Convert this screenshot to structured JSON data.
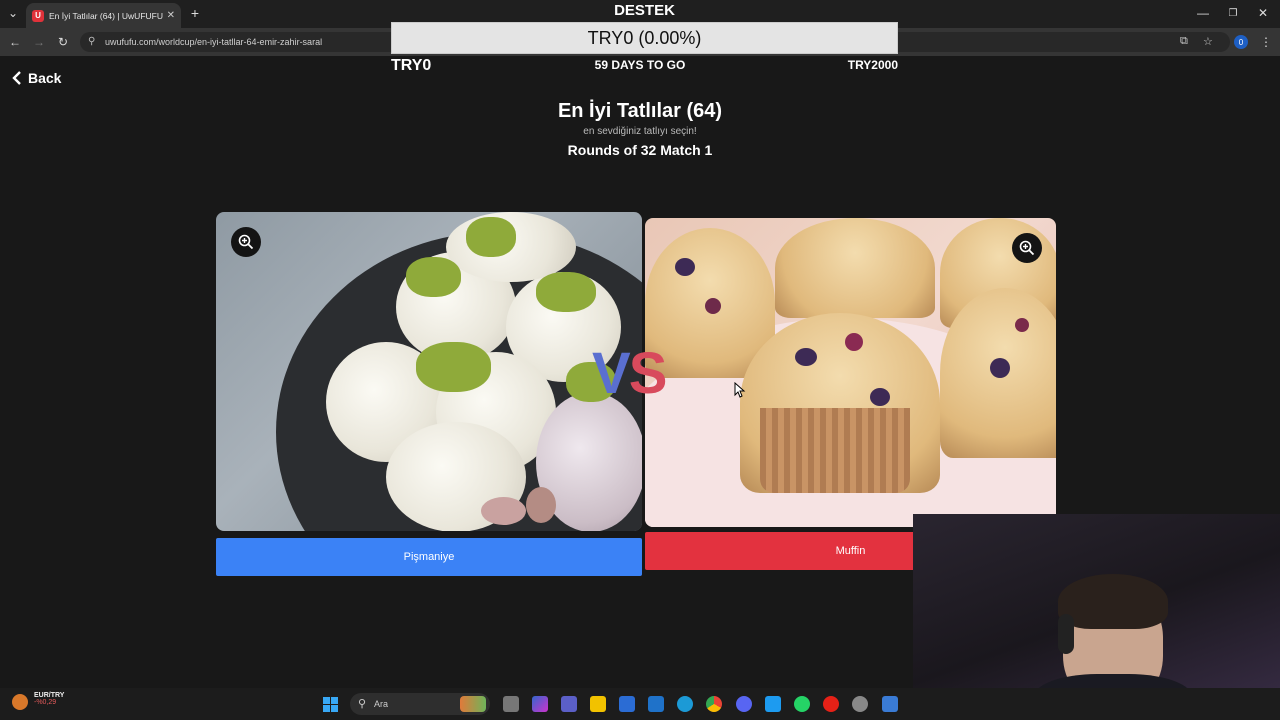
{
  "browser": {
    "tab_title": "En İyi Tatlılar (64) | UwUFUFU",
    "tab_favicon": "U",
    "url": "uwufufu.com/worldcup/en-iyi-tatllar-64-emir-zahir-saral",
    "profile_initial": "0"
  },
  "donation": {
    "title": "DESTEK",
    "progress_text": "TRY0 (0.00%)",
    "progress_fraction": 0.0,
    "current": "TRY0",
    "countdown": "59 DAYS TO GO",
    "goal": "TRY2000"
  },
  "page": {
    "back_label": "Back",
    "title": "En İyi Tatlılar (64)",
    "subtitle": "en sevdiğiniz tatlıyı seçin!",
    "round": "Rounds of 32 Match 1"
  },
  "match": {
    "vs_v": "V",
    "vs_s": "S",
    "left": {
      "label": "Pişmaniye",
      "color": "#3b82f6"
    },
    "right": {
      "label": "Muffin",
      "color": "#e3323f"
    }
  },
  "taskbar": {
    "weather_title": "EUR/TRY",
    "weather_change": "-%0,29",
    "search_placeholder": "Ara"
  }
}
